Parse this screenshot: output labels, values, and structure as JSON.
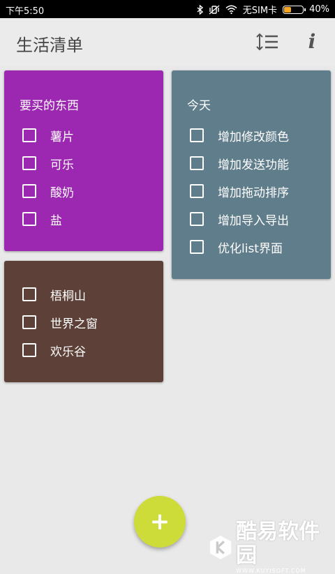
{
  "status_bar": {
    "time": "下午5:50",
    "carrier": "无SIM卡",
    "battery": "40%",
    "battery_level": 0.4
  },
  "app_bar": {
    "title": "生活清单",
    "icons": [
      "sort-icon",
      "info-icon"
    ],
    "info_glyph": "i"
  },
  "lists": [
    {
      "title": "要买的东西",
      "color": "#9c27b0",
      "items": [
        {
          "label": "薯片",
          "checked": false
        },
        {
          "label": "可乐",
          "checked": false
        },
        {
          "label": "酸奶",
          "checked": false
        },
        {
          "label": "盐",
          "checked": false
        }
      ]
    },
    {
      "title": "",
      "color": "#5d4037",
      "items": [
        {
          "label": "梧桐山",
          "checked": false
        },
        {
          "label": "世界之窗",
          "checked": false
        },
        {
          "label": "欢乐谷",
          "checked": false
        }
      ]
    },
    {
      "title": "今天",
      "color": "#607d8b",
      "items": [
        {
          "label": "增加修改颜色",
          "checked": false
        },
        {
          "label": "增加发送功能",
          "checked": false
        },
        {
          "label": "增加拖动排序",
          "checked": false
        },
        {
          "label": "增加导入导出",
          "checked": false
        },
        {
          "label": "优化list界面",
          "checked": false
        }
      ]
    }
  ],
  "fab": {
    "label": "+",
    "color": "#cddc39"
  },
  "watermark": {
    "text": "酷易软件园",
    "url": "WWW.KUYISOFT.COM"
  }
}
